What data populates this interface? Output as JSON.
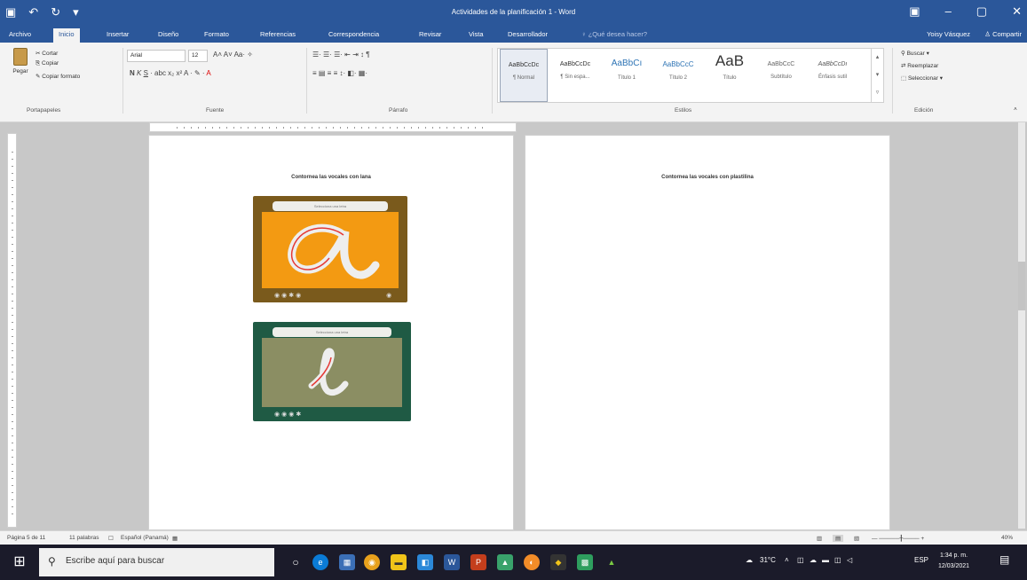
{
  "window": {
    "title": "Actividades de la planificación 1 - Word",
    "user": "Yoisy Vásquez",
    "share_label": "Compartir"
  },
  "tabs": [
    "Archivo",
    "Inicio",
    "Insertar",
    "Diseño",
    "Formato",
    "Referencias",
    "Correspondencia",
    "Revisar",
    "Vista",
    "Desarrollador"
  ],
  "tell_me": "¿Qué desea hacer?",
  "clipboard": {
    "paste": "Pegar",
    "cut": "Cortar",
    "copy": "Copiar",
    "format_painter": "Copiar formato",
    "group": "Portapapeles"
  },
  "font": {
    "name": "Arial",
    "size": "12",
    "group": "Fuente"
  },
  "paragraph": {
    "group": "Párrafo"
  },
  "styles": {
    "items": [
      {
        "sample": "AaBbCcDc",
        "name": "¶ Normal"
      },
      {
        "sample": "AaBbCcDc",
        "name": "¶ Sin espa..."
      },
      {
        "sample": "AaBbCı",
        "name": "Título 1"
      },
      {
        "sample": "AaBbCcC",
        "name": "Título 2"
      },
      {
        "sample": "AaB",
        "name": "Título"
      },
      {
        "sample": "AaBbCcC",
        "name": "Subtítulo"
      },
      {
        "sample": "AaBbCcDı",
        "name": "Énfasis sutil"
      }
    ],
    "group": "Estilos"
  },
  "editing": {
    "find": "Buscar",
    "replace": "Reemplazar",
    "select": "Seleccionar",
    "group": "Edición"
  },
  "document": {
    "left_page_caption": "Contornea las vocales con lana",
    "right_page_caption": "Contornea las vocales con plastilina",
    "card_banner": "Selecciona una letra"
  },
  "status": {
    "page": "Página 5 de 11",
    "words": "11 palabras",
    "language": "Español (Panamá)",
    "zoom": "40%"
  },
  "taskbar": {
    "search_placeholder": "Escribe aquí para buscar",
    "weather": "31°C",
    "lang": "ESP",
    "time": "1:34 p. m.",
    "date": "12/03/2021"
  },
  "colors": {
    "word_blue": "#2b579a",
    "card_orange": "#f39a12",
    "card_green": "#8b8e63",
    "card_frame_brown": "#7a5a1c",
    "card_frame_teal": "#1f5a44"
  }
}
